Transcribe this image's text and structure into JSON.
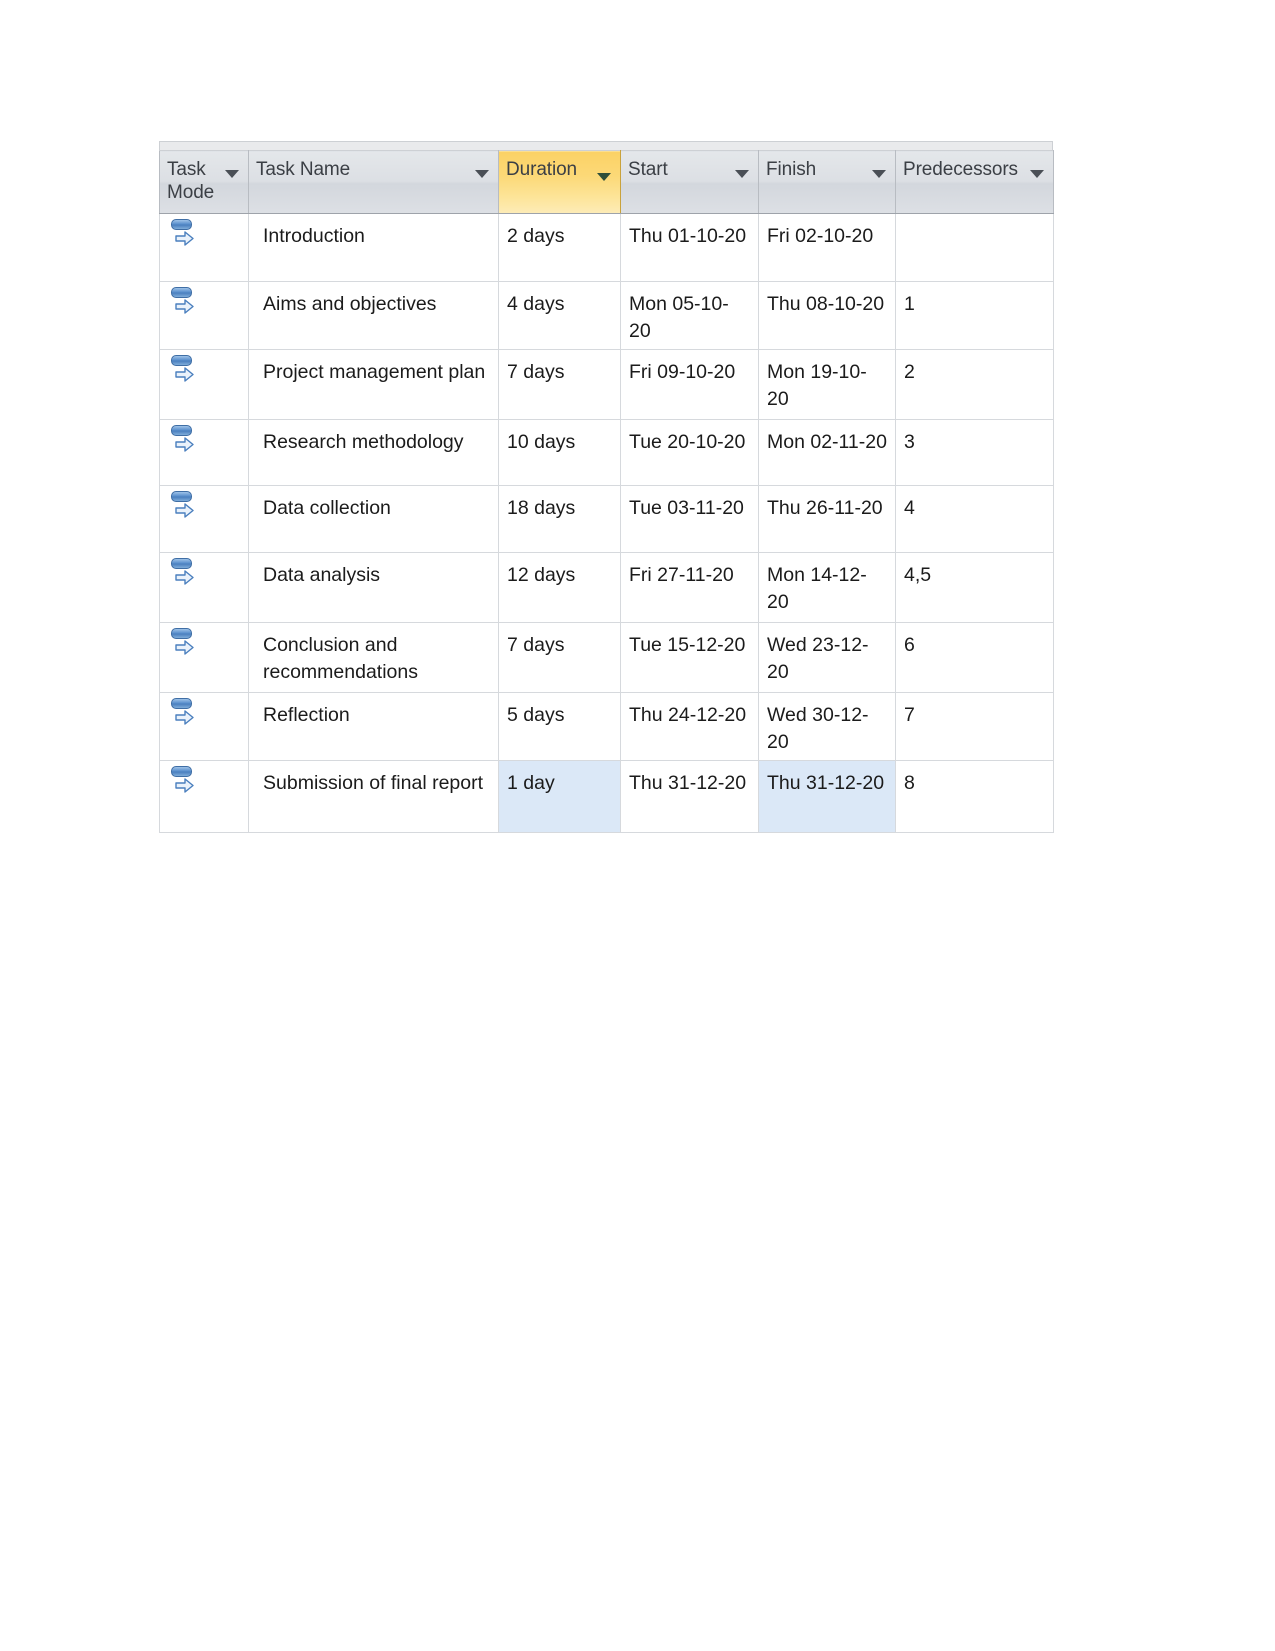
{
  "table": {
    "columns": [
      {
        "key": "task_mode",
        "label": "Task\nMode",
        "sorted": false,
        "filter_icon": "chevron-down-icon"
      },
      {
        "key": "task_name",
        "label": "Task Name",
        "sorted": false,
        "filter_icon": "chevron-down-icon"
      },
      {
        "key": "duration",
        "label": "Duration",
        "sorted": true,
        "filter_icon": "chevron-down-icon"
      },
      {
        "key": "start",
        "label": "Start",
        "sorted": false,
        "filter_icon": "chevron-down-icon"
      },
      {
        "key": "finish",
        "label": "Finish",
        "sorted": false,
        "filter_icon": "chevron-down-icon"
      },
      {
        "key": "predecessors",
        "label": "Predecessors",
        "sorted": false,
        "filter_icon": "chevron-down-icon"
      }
    ],
    "rows": [
      {
        "task_mode_icon": "auto-scheduled-icon",
        "task_name": "Introduction",
        "duration": "2 days",
        "start": "Thu 01-10-20",
        "finish": "Fri 02-10-20",
        "predecessors": ""
      },
      {
        "task_mode_icon": "auto-scheduled-icon",
        "task_name": "Aims and objectives",
        "duration": "4 days",
        "start": "Mon 05-10-20",
        "finish": "Thu 08-10-20",
        "predecessors": "1"
      },
      {
        "task_mode_icon": "auto-scheduled-icon",
        "task_name": "Project management plan",
        "duration": "7 days",
        "start": "Fri 09-10-20",
        "finish": "Mon 19-10-20",
        "predecessors": "2"
      },
      {
        "task_mode_icon": "auto-scheduled-icon",
        "task_name": "Research methodology",
        "duration": "10 days",
        "start": "Tue 20-10-20",
        "finish": "Mon 02-11-20",
        "predecessors": "3"
      },
      {
        "task_mode_icon": "auto-scheduled-icon",
        "task_name": "Data collection",
        "duration": "18 days",
        "start": "Tue 03-11-20",
        "finish": "Thu 26-11-20",
        "predecessors": "4"
      },
      {
        "task_mode_icon": "auto-scheduled-icon",
        "task_name": "Data analysis",
        "duration": "12 days",
        "start": "Fri 27-11-20",
        "finish": "Mon 14-12-20",
        "predecessors": "4,5"
      },
      {
        "task_mode_icon": "auto-scheduled-icon",
        "task_name": "Conclusion and recommendations",
        "duration": "7 days",
        "start": "Tue 15-12-20",
        "finish": "Wed 23-12-20",
        "predecessors": "6"
      },
      {
        "task_mode_icon": "auto-scheduled-icon",
        "task_name": "Reflection",
        "duration": "5 days",
        "start": "Thu 24-12-20",
        "finish": "Wed 30-12-20",
        "predecessors": "7"
      },
      {
        "task_mode_icon": "auto-scheduled-icon",
        "task_name": "Submission of final report",
        "duration": "1 day",
        "start": "Thu 31-12-20",
        "finish": "Thu 31-12-20",
        "predecessors": "8"
      }
    ],
    "selection": {
      "row_index": 8,
      "selected_columns": [
        "duration",
        "finish"
      ]
    }
  },
  "colors": {
    "sorted_header": "#fcd978",
    "header_background": "#dcdfe4",
    "selected_cell": "#dbe8f7",
    "grid_line": "#d6d9dd",
    "task_mode_icon": "#5b90cd"
  }
}
